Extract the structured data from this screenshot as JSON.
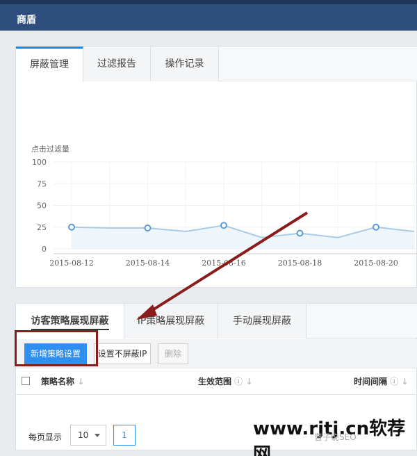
{
  "app": {
    "title": "商盾"
  },
  "main_tabs": [
    {
      "label": "屏蔽管理",
      "active": true
    },
    {
      "label": "过滤报告",
      "active": false
    },
    {
      "label": "操作记录",
      "active": false
    }
  ],
  "chart_data": {
    "type": "line",
    "ylabel": "点击过滤量",
    "y_ticks": [
      "100",
      "75",
      "50",
      "25",
      "0"
    ],
    "ylim": [
      0,
      100
    ],
    "x_tick_labels": [
      "2015-08-12",
      "2015-08-14",
      "2015-08-16",
      "2015-08-18",
      "2015-08-20"
    ],
    "x": [
      "2015-08-12",
      "2015-08-13",
      "2015-08-14",
      "2015-08-15",
      "2015-08-16",
      "2015-08-17",
      "2015-08-18",
      "2015-08-19",
      "2015-08-20",
      "2015-08-21"
    ],
    "values": [
      25,
      24,
      24,
      20,
      27,
      13,
      18,
      13,
      25,
      20
    ],
    "marker_points": [
      "2015-08-12",
      "2015-08-14",
      "2015-08-16",
      "2015-08-18",
      "2015-08-20"
    ],
    "grid": true,
    "colors": {
      "line": "#a9cbe6",
      "fill": "#eef5fb",
      "marker": "#5b9bd5"
    }
  },
  "sub_tabs": [
    {
      "label": "访客策略展现屏蔽",
      "active": true
    },
    {
      "label": "IP策略展现屏蔽",
      "active": false
    },
    {
      "label": "手动展现屏蔽",
      "active": false
    }
  ],
  "toolbar": {
    "new_policy": "新增策略设置",
    "no_block_ip": "设置不屏蔽IP",
    "delete": "删除"
  },
  "table": {
    "columns": [
      {
        "label": "策略名称",
        "sort_icon": "sort-down-icon"
      },
      {
        "label": "生效范围",
        "help_icon": "help-circle-icon",
        "sort_icon": "sort-down-icon"
      },
      {
        "label": "时间间隔",
        "help_icon": "help-circle-icon",
        "sort_icon": "sort-down-icon"
      }
    ]
  },
  "pagination": {
    "per_page_label": "每页显示",
    "per_page_value": "10",
    "current_page": "1"
  },
  "watermark": {
    "site": "www.rjtj.cn软荐网",
    "wechat": "曹子说SEO"
  },
  "colors": {
    "topbar": "#2e4f7e",
    "accent": "#2f8ff0",
    "annotation": "#8b1c1c"
  }
}
